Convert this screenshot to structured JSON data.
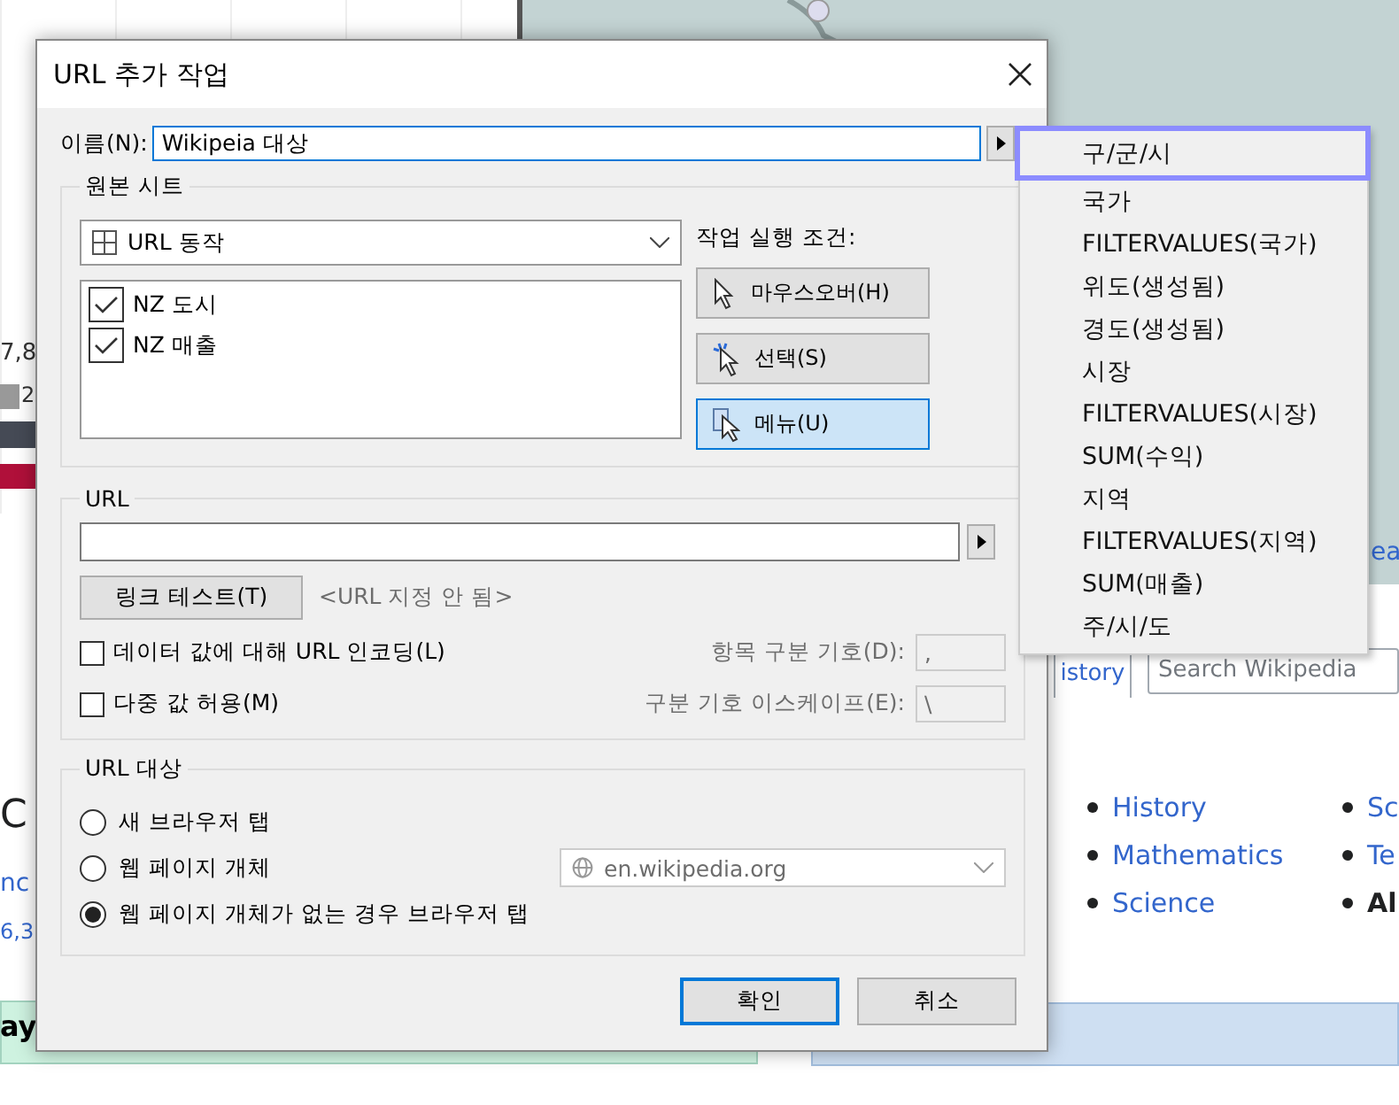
{
  "background_page": {
    "chart_labels": [
      "7,8",
      "2"
    ],
    "heading_fragment": "C",
    "link_fragments": [
      "nc",
      "6,3"
    ],
    "banner_fragment": "ay",
    "top_link_fragment": "ea",
    "tab_fragment": "istory",
    "search": {
      "placeholder": "Search Wikipedia"
    },
    "topic_columns": [
      [
        {
          "text": "History",
          "bold": false
        },
        {
          "text": "Mathematics",
          "bold": false
        },
        {
          "text": "Science",
          "bold": false
        }
      ],
      [
        {
          "text": "Sc",
          "bold": false
        },
        {
          "text": "Te",
          "bold": false
        },
        {
          "text": "Al",
          "bold": true
        }
      ]
    ]
  },
  "dialog": {
    "title": "URL 추가 작업",
    "name_label": "이름(N):",
    "name_value": "Wikipeia 대상",
    "source_sheets": {
      "legend": "원본 시트",
      "dropdown": "URL 동작",
      "sheets": [
        {
          "label": "NZ 도시",
          "checked": true
        },
        {
          "label": "NZ 매출",
          "checked": true
        }
      ]
    },
    "run_on": {
      "label": "작업 실행 조건:",
      "options": [
        {
          "label": "마우스오버(H)",
          "kind": "hover",
          "selected": false
        },
        {
          "label": "선택(S)",
          "kind": "select",
          "selected": false
        },
        {
          "label": "메뉴(U)",
          "kind": "menu",
          "selected": true
        }
      ]
    },
    "url": {
      "legend": "URL",
      "test_button": "링크 테스트(T)",
      "status": "<URL 지정 안 됨>",
      "options": [
        {
          "label": "데이터 값에 대해 URL 인코딩(L)",
          "checked": false,
          "field_label": "항목 구분 기호(D):",
          "field_value": ",",
          "disabled": true
        },
        {
          "label": "다중 값 허용(M)",
          "checked": false,
          "field_label": "구분 기호 이스케이프(E):",
          "field_value": "\\",
          "disabled": true
        }
      ]
    },
    "url_target": {
      "legend": "URL 대상",
      "options": [
        {
          "label": "새 브라우저 탭",
          "selected": false
        },
        {
          "label": "웹 페이지 개체",
          "selected": false
        },
        {
          "label": "웹 페이지 개체가 없는 경우 브라우저 탭",
          "selected": true
        }
      ],
      "web_object": {
        "value": "en.wikipedia.org",
        "disabled": true
      }
    },
    "buttons": [
      {
        "label": "확인",
        "default": true
      },
      {
        "label": "취소",
        "default": false
      }
    ]
  },
  "field_menu": {
    "items": [
      {
        "label": "구/군/시",
        "selected": true
      },
      {
        "label": "국가",
        "selected": false
      },
      {
        "label": "FILTERVALUES(국가)",
        "selected": false
      },
      {
        "label": "위도(생성됨)",
        "selected": false
      },
      {
        "label": "경도(생성됨)",
        "selected": false
      },
      {
        "label": "시장",
        "selected": false
      },
      {
        "label": "FILTERVALUES(시장)",
        "selected": false
      },
      {
        "label": "SUM(수익)",
        "selected": false
      },
      {
        "label": "지역",
        "selected": false
      },
      {
        "label": "FILTERVALUES(지역)",
        "selected": false
      },
      {
        "label": "SUM(매출)",
        "selected": false
      },
      {
        "label": "주/시/도",
        "selected": false
      }
    ]
  }
}
